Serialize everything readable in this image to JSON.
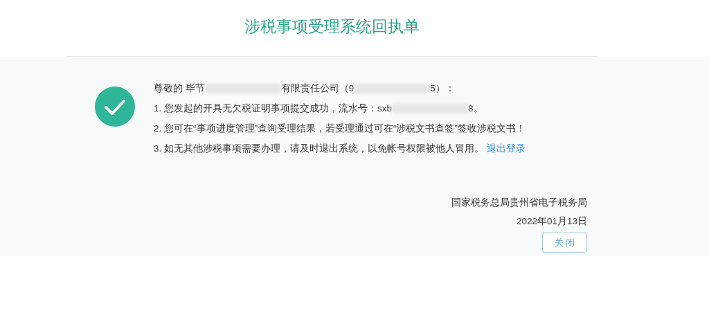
{
  "title": "涉税事项受理系统回执单",
  "message": {
    "lines": [
      {
        "segments": [
          {
            "kind": "text",
            "text": "尊敬的 毕节"
          },
          {
            "kind": "redacted"
          },
          {
            "kind": "text",
            "text": "有限责任公司（9"
          },
          {
            "kind": "redacted"
          },
          {
            "kind": "text",
            "text": "5）："
          }
        ]
      },
      {
        "segments": [
          {
            "kind": "text",
            "text": "1. 您发起的开具无欠税证明事项提交成功，流水号：sxb"
          },
          {
            "kind": "redacted"
          },
          {
            "kind": "text",
            "text": "8。"
          }
        ]
      },
      {
        "segments": [
          {
            "kind": "text",
            "text": "2. 您可在“事项进度管理”查询受理结果，若受理通过可在“涉税文书查签”签收涉税文书！"
          }
        ]
      },
      {
        "segments": [
          {
            "kind": "text",
            "text": "3. 如无其他涉税事项需要办理，请及时退出系统，以免帐号权限被他人冒用。"
          },
          {
            "kind": "link",
            "text": "退出登录"
          }
        ]
      }
    ]
  },
  "signature": "国家税务总局贵州省电子税务局",
  "date": "2022年01月13日",
  "close_button": "关 闭"
}
